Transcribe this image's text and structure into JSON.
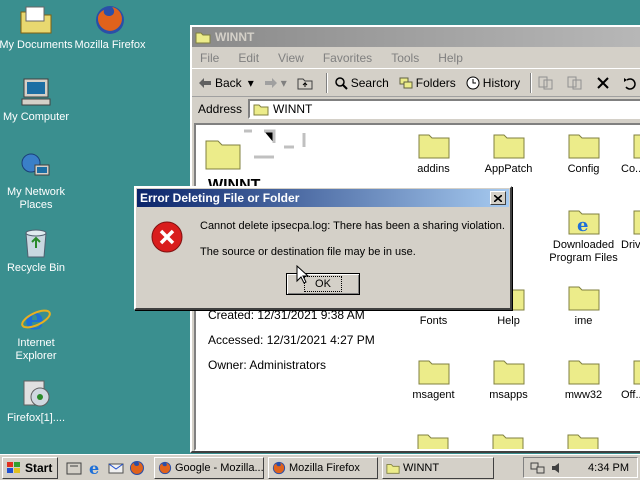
{
  "desktop": {
    "icons": [
      {
        "label": "My Documents",
        "icon": "folder-documents-icon"
      },
      {
        "label": "Mozilla Firefox",
        "icon": "firefox-icon"
      },
      {
        "label": "My Computer",
        "icon": "computer-icon"
      },
      {
        "label": "My Network Places",
        "icon": "network-places-icon"
      },
      {
        "label": "Recycle Bin",
        "icon": "recycle-bin-icon"
      },
      {
        "label": "Internet Explorer",
        "icon": "ie-icon"
      },
      {
        "label": "Firefox[1]....",
        "icon": "installer-icon"
      }
    ]
  },
  "explorer": {
    "title": "WINNT",
    "menu": [
      "File",
      "Edit",
      "View",
      "Favorites",
      "Tools",
      "Help"
    ],
    "toolbar": {
      "back": "Back",
      "search": "Search",
      "folders": "Folders",
      "history": "History"
    },
    "address_label": "Address",
    "address_value": "WINNT",
    "info": {
      "name": "WINNT",
      "created": "Created: 12/31/2021 9:38 AM",
      "accessed": "Accessed: 12/31/2021 4:27 PM",
      "owner": "Owner: Administrators"
    },
    "folders": [
      "addins",
      "AppPatch",
      "Config",
      "Co...",
      "g",
      "Downloaded Program Files",
      "Driv...",
      "Fonts",
      "Help",
      "ime",
      "msagent",
      "msapps",
      "mww32",
      "Off..."
    ]
  },
  "dialog": {
    "title": "Error Deleting File or Folder",
    "message1": "Cannot delete ipsecpa.log: There has been a sharing violation.",
    "message2": "The source or destination file may be in use.",
    "ok_label": "OK"
  },
  "taskbar": {
    "start_label": "Start",
    "tasks": [
      "Google - Mozilla...",
      "Mozilla Firefox",
      "WINNT"
    ],
    "clock": "4:34 PM"
  },
  "colors": {
    "desktop": "#3a8f8f",
    "dialog_title": "#0a246a",
    "error_red": "#d91d1d",
    "folder_yellow": "#ecec8a"
  }
}
